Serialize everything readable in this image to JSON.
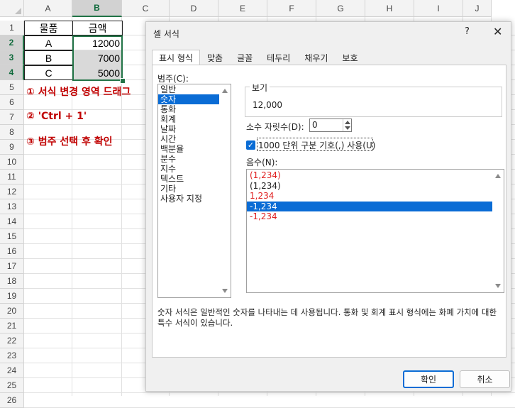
{
  "sheet": {
    "columns": [
      "A",
      "B",
      "C",
      "D",
      "E",
      "F",
      "G",
      "H",
      "I",
      "J"
    ],
    "rows": [
      "1",
      "2",
      "3",
      "4",
      "5",
      "6",
      "7",
      "8",
      "9",
      "10",
      "11",
      "12",
      "13",
      "14",
      "15",
      "16",
      "17",
      "18",
      "19",
      "20",
      "21",
      "22",
      "23",
      "24",
      "25",
      "26"
    ],
    "cells": {
      "a1": "물품",
      "b1": "금액",
      "a2": "A",
      "b2": "12000",
      "a3": "B",
      "b3": "7000",
      "a4": "C",
      "b4": "5000"
    },
    "notes": [
      "① 서식 변경 영역 드래그",
      "② 'Ctrl + 1'",
      "③ 범주 선택 후 확인"
    ],
    "note_color": "#c00000",
    "selection_color": "#217346"
  },
  "dialog": {
    "title": "셀 서식",
    "help": "?",
    "close": "✕",
    "tabs": [
      "표시 형식",
      "맞춤",
      "글꼴",
      "테두리",
      "채우기",
      "보호"
    ],
    "active_tab": "표시 형식",
    "category_label": "범주(C):",
    "categories": [
      "일반",
      "숫자",
      "통화",
      "회계",
      "날짜",
      "시간",
      "백분율",
      "분수",
      "지수",
      "텍스트",
      "기타",
      "사용자 지정"
    ],
    "selected_category": "숫자",
    "sample_label": "보기",
    "sample_value": "12,000",
    "decimal_label": "소수 자릿수(D):",
    "decimal_value": "0",
    "thousands_label": "1000 단위 구분 기호(,) 사용(U)",
    "thousands_checked": true,
    "negative_label": "음수(N):",
    "negative_options": [
      {
        "text": "(1,234)",
        "color": "red"
      },
      {
        "text": "(1,234)",
        "color": "black"
      },
      {
        "text": "1,234",
        "color": "red"
      },
      {
        "text": "-1,234",
        "color": "black",
        "selected": true
      },
      {
        "text": "-1,234",
        "color": "red"
      }
    ],
    "description": "숫자 서식은 일반적인 숫자를 나타내는 데 사용됩니다. 통화 및 회계 표시 형식에는 화폐 가치에 대한 특수 서식이 있습니다.",
    "ok_label": "확인",
    "cancel_label": "취소",
    "accent_color": "#0a6cd5"
  }
}
